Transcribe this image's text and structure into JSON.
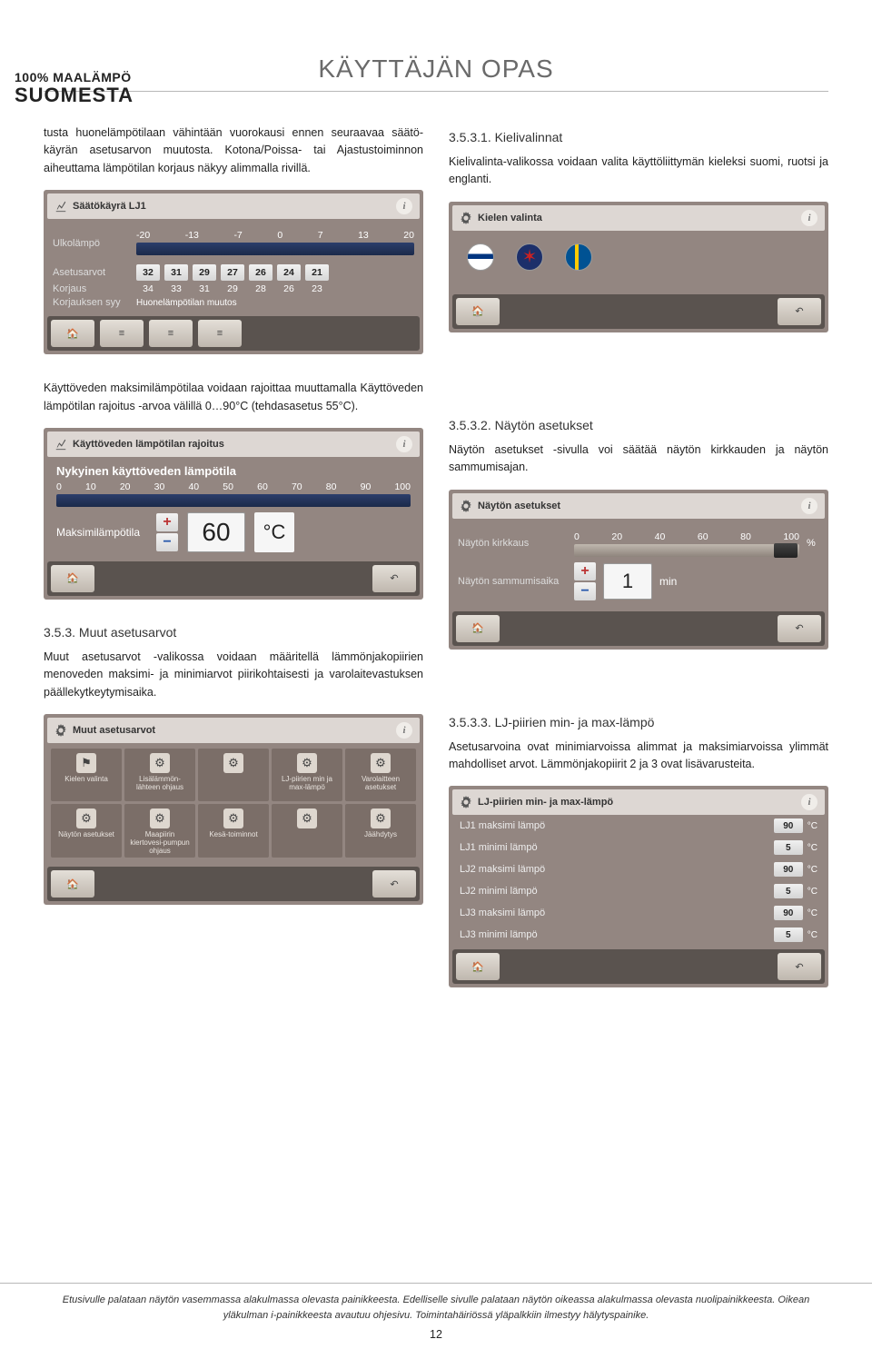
{
  "brand": {
    "line1": "100% MAALÄMPÖ",
    "line2": "SUOMESTA"
  },
  "page_title": "KÄYTTÄJÄN OPAS",
  "left": {
    "para1": "tusta huonelämpötilaan vähintään vuorokausi ennen seuraavaa säätö­käyrän asetusarvon muutosta. Kotona/Poissa- tai Ajastustoiminnon aiheuttama lämpötilan korjaus näkyy alimmalla rivillä.",
    "panel1": {
      "title": "Säätökäyrä LJ1",
      "rows": {
        "ulkolampo": "Ulkolämpö",
        "ulkolampo_vals": [
          "-20",
          "-13",
          "-7",
          "0",
          "7",
          "13",
          "20"
        ],
        "asetusarvot": "Asetusarvot",
        "asetusarvot_vals": [
          "32",
          "31",
          "29",
          "27",
          "26",
          "24",
          "21"
        ],
        "korjaus": "Korjaus",
        "korjaus_vals": [
          "34",
          "33",
          "31",
          "29",
          "28",
          "26",
          "23"
        ],
        "korjauksen_syy": "Korjauksen syy",
        "korjauksen_syy_val": "Huonelämpötilan muutos"
      }
    },
    "para2": "Käyttöveden maksimilämpötilaa voidaan rajoittaa muuttamalla Käyttö­veden lämpötilan rajoitus -arvoa välillä 0…90°C (tehdasasetus 55°C).",
    "panel2": {
      "title": "Käyttöveden lämpötilan rajoitus",
      "big_title": "Nykyinen käyttöveden lämpötila",
      "scale": [
        "0",
        "10",
        "20",
        "30",
        "40",
        "50",
        "60",
        "70",
        "80",
        "90",
        "100"
      ],
      "max_label": "Maksimilämpötila",
      "value": "60",
      "unit": "°C"
    },
    "h353": "3.5.3. Muut asetusarvot",
    "para3": "Muut asetusarvot -valikossa voidaan määritellä lämmönjakopiirien menoveden maksimi- ja minimiarvot piirikohtaisesti ja varolaitevastuk­sen päällekytkeytymisaika.",
    "panel3": {
      "title": "Muut asetusarvot",
      "cells": [
        {
          "icon": "flag",
          "label": "Kielen valinta"
        },
        {
          "icon": "gear",
          "label": "Lisälämmön-lähteen ohjaus"
        },
        {
          "icon": "gear",
          "label": ""
        },
        {
          "icon": "gear",
          "label": "LJ-piirien min ja max-lämpö"
        },
        {
          "icon": "gear",
          "label": "Varolaitteen asetukset"
        },
        {
          "icon": "gear",
          "label": "Näytön asetukset"
        },
        {
          "icon": "gear",
          "label": "Maapiirin kiertovesi-pumpun ohjaus"
        },
        {
          "icon": "gear",
          "label": "Kesä-toiminnot"
        },
        {
          "icon": "gear",
          "label": ""
        },
        {
          "icon": "gear",
          "label": "Jäähdytys"
        }
      ]
    }
  },
  "right": {
    "h3531": "3.5.3.1. Kielivalinnat",
    "para1": "Kielivalinta-valikossa voidaan valita käyttöliittymän kieleksi suomi, ruotsi ja englanti.",
    "panel1": {
      "title": "Kielen valinta"
    },
    "h3532": "3.5.3.2. Näytön asetukset",
    "para2": "Näytön asetukset -sivulla voi säätää näytön kirkkauden ja näytön sammumisajan.",
    "panel2": {
      "title": "Näytön asetukset",
      "kirkkaus_label": "Näytön kirkkaus",
      "kirkkaus_scale": [
        "0",
        "20",
        "40",
        "60",
        "80",
        "100"
      ],
      "pct": "%",
      "sammumis_label": "Näytön sammumisaika",
      "sammumis_value": "1",
      "sammumis_unit": "min"
    },
    "h3533": "3.5.3.3. LJ-piirien min- ja max-lämpö",
    "para3": "Asetusarvoina ovat minimiarvoissa alimmat ja maksimiarvoissa ylimmät mahdolliset arvot. Lämmönjakopiirit 2 ja 3 ovat lisävarusteita.",
    "panel3": {
      "title": "LJ-piirien min- ja max-lämpö",
      "rows": [
        {
          "label": "LJ1 maksimi lämpö",
          "val": "90",
          "unit": "°C"
        },
        {
          "label": "LJ1 minimi lämpö",
          "val": "5",
          "unit": "°C"
        },
        {
          "label": "LJ2 maksimi lämpö",
          "val": "90",
          "unit": "°C"
        },
        {
          "label": "LJ2 minimi lämpö",
          "val": "5",
          "unit": "°C"
        },
        {
          "label": "LJ3 maksimi lämpö",
          "val": "90",
          "unit": "°C"
        },
        {
          "label": "LJ3 minimi lämpö",
          "val": "5",
          "unit": "°C"
        }
      ]
    }
  },
  "footer": {
    "text1": "Etusivulle palataan näytön vasemmassa alakulmassa olevasta painikkeesta. Edelliselle sivulle palataan näytön oikeassa alakulmassa olevasta nuolipai­nikkeesta. Oikean yläkulman i-painikkeesta avautuu ohjesivu. Toimintahäiriössä yläpalkkiin ilmestyy hälytyspainike.",
    "page": "12"
  }
}
